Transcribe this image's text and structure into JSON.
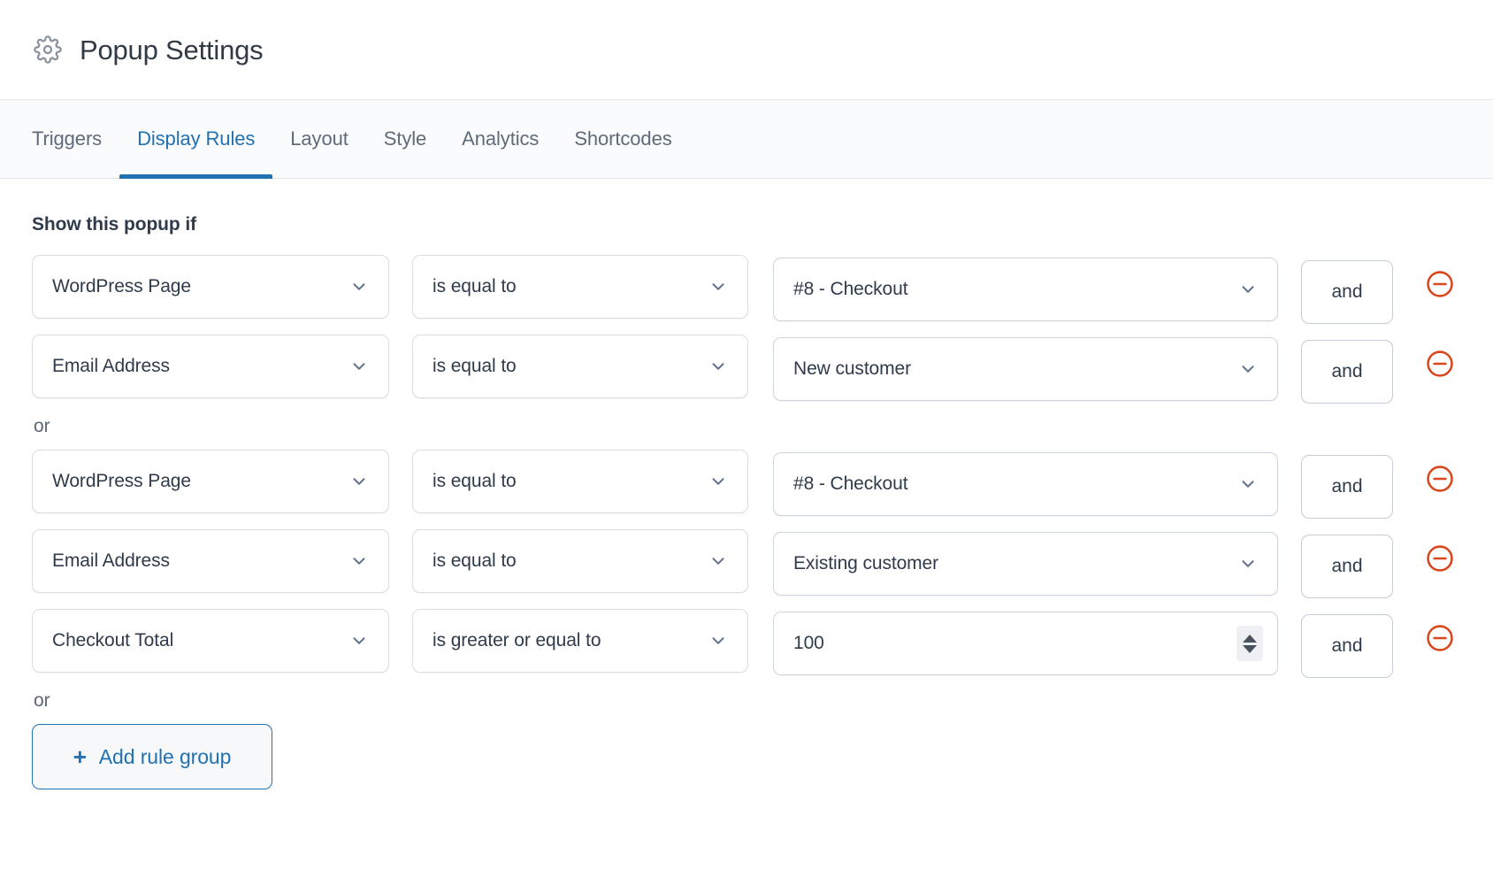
{
  "header": {
    "icon": "gear-icon",
    "title": "Popup Settings"
  },
  "tabs": [
    {
      "label": "Triggers",
      "active": false
    },
    {
      "label": "Display Rules",
      "active": true
    },
    {
      "label": "Layout",
      "active": false
    },
    {
      "label": "Style",
      "active": false
    },
    {
      "label": "Analytics",
      "active": false
    },
    {
      "label": "Shortcodes",
      "active": false
    }
  ],
  "main": {
    "section_label": "Show this popup if",
    "or_separator": "or",
    "and_label": "and",
    "remove_icon": "minus-circle-icon",
    "add_rule_group": {
      "label": "Add rule group",
      "icon": "plus-icon"
    },
    "groups": [
      {
        "rows": [
          {
            "subject": "WordPress Page",
            "operator": "is equal to",
            "value": "#8 - Checkout",
            "value_type": "select",
            "connector": "and"
          },
          {
            "subject": "Email Address",
            "operator": "is equal to",
            "value": "New customer",
            "value_type": "select",
            "connector": "and"
          }
        ]
      },
      {
        "rows": [
          {
            "subject": "WordPress Page",
            "operator": "is equal to",
            "value": "#8 - Checkout",
            "value_type": "select",
            "connector": "and"
          },
          {
            "subject": "Email Address",
            "operator": "is equal to",
            "value": "Existing customer",
            "value_type": "select",
            "connector": "and"
          },
          {
            "subject": "Checkout Total",
            "operator": "is greater or equal to",
            "value": "100",
            "value_type": "number",
            "connector": "and"
          }
        ]
      }
    ]
  },
  "colors": {
    "accent_blue": "#2271b1",
    "remove_red": "#d9471d",
    "text_dark": "#2f3b4a",
    "text_muted": "#5f6b7a",
    "border": "#d8dde4",
    "tabbar_bg": "#fafbfc"
  }
}
